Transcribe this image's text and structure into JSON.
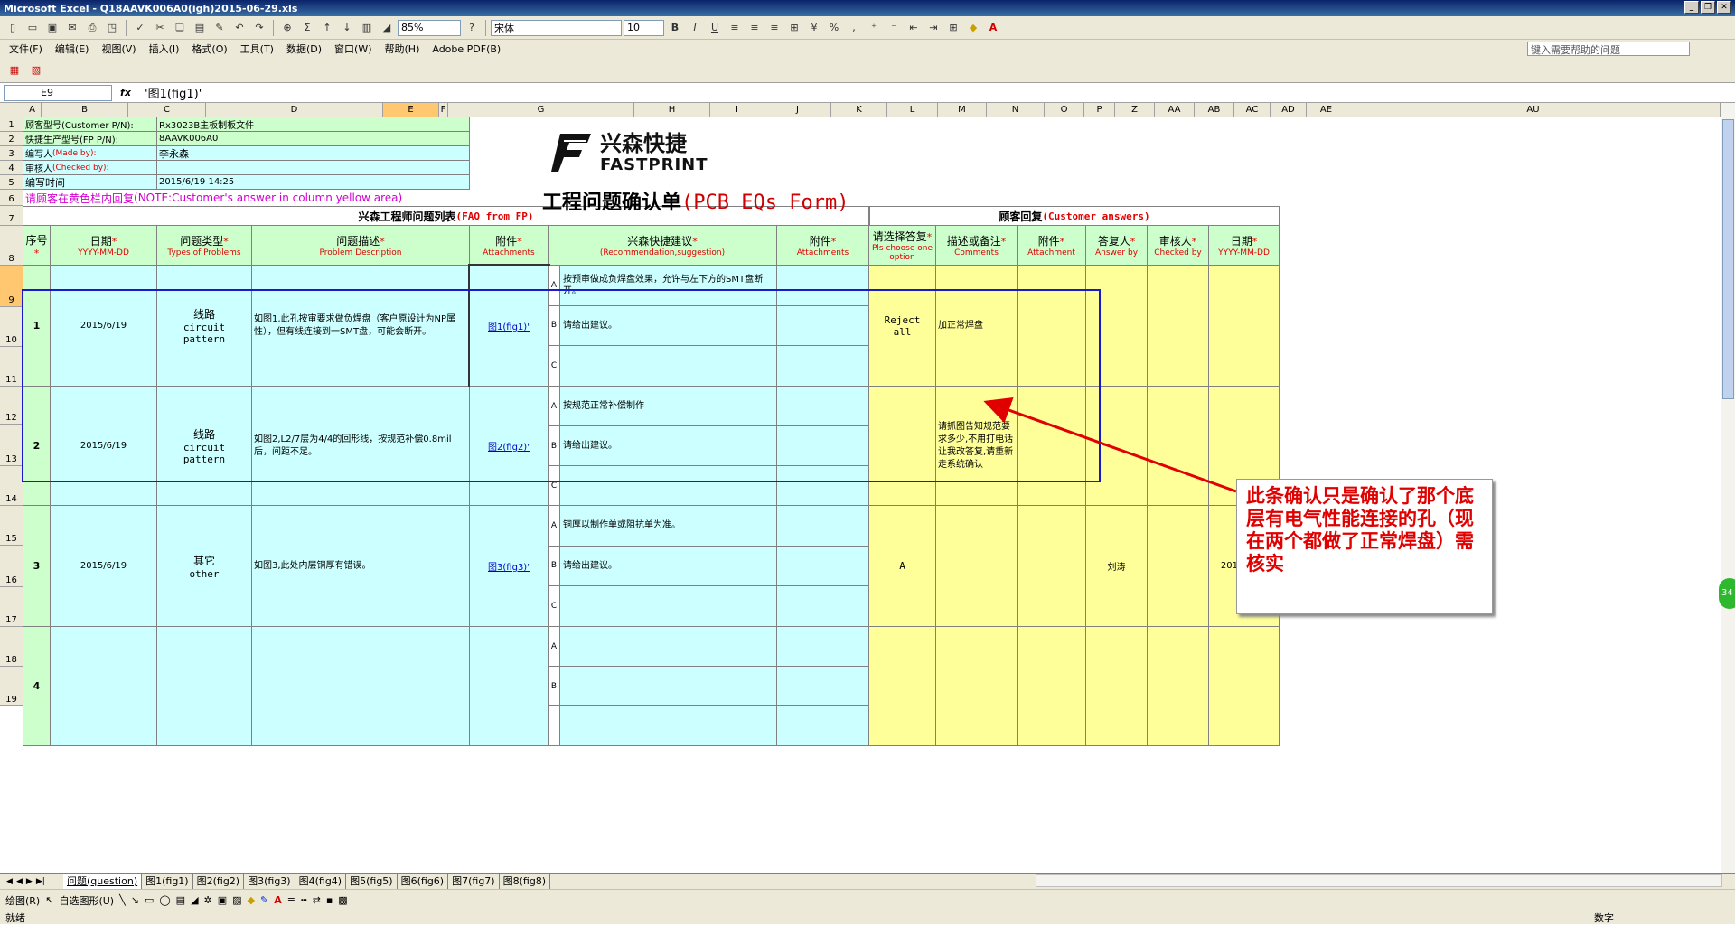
{
  "window": {
    "title": "Microsoft Excel - Q18AAVK006A0(igh)2015-06-29.xls"
  },
  "toolbar": {
    "zoom": "85%",
    "font_name": "宋体",
    "font_size": "10"
  },
  "menu": {
    "items": [
      "文件(F)",
      "编辑(E)",
      "视图(V)",
      "插入(I)",
      "格式(O)",
      "工具(T)",
      "数据(D)",
      "窗口(W)",
      "帮助(H)",
      "Adobe PDF(B)"
    ],
    "help_placeholder": "键入需要帮助的问题"
  },
  "formula": {
    "cell_ref": "E9",
    "fx": "fx",
    "content": "'图1(fig1)'"
  },
  "columns": [
    "A",
    "B",
    "C",
    "D",
    "E",
    "F",
    "G",
    "H",
    "I",
    "J",
    "K",
    "L",
    "M",
    "N",
    "O",
    "P",
    "Z",
    "AA",
    "AB",
    "AC",
    "AD",
    "AE",
    "AU"
  ],
  "rows": [
    "1",
    "2",
    "3",
    "4",
    "5",
    "6",
    "7",
    "8",
    "9",
    "10",
    "11",
    "12",
    "13",
    "14",
    "15",
    "16",
    "17",
    "18",
    "19"
  ],
  "header_info": {
    "customer_pn_label": "顾客型号(Customer P/N):",
    "customer_pn_value": "Rx3023B主板制板文件",
    "fp_pn_label": "快捷生产型号(FP P/N):",
    "fp_pn_value": "8AAVK006A0",
    "made_by_label": "编写人",
    "made_by_en": "(Made by):",
    "made_by_value": "李永森",
    "checked_by_label": "审核人",
    "checked_by_en": "(Checked by):",
    "time_label": "编写时间",
    "time_value": "2015/6/19 14:25",
    "note_cn": "请顾客在黄色栏内回复",
    "note_en": "(NOTE:Customer's answer in column yellow area)"
  },
  "logo": {
    "cn": "兴森快捷",
    "en": "FASTPRINT"
  },
  "form_title": {
    "cn": "工程问题确认单",
    "en": "(PCB EQs Form)"
  },
  "section_headers": {
    "fp_cn": "兴森工程师问题列表",
    "fp_en": "(FAQ from FP)",
    "cust_cn": "顾客回复",
    "cust_en": "(Customer answers)"
  },
  "col_headers": {
    "seq_cn": "序号",
    "date_cn": "日期",
    "date_en": "YYYY-MM-DD",
    "type_cn": "问题类型",
    "type_en": "Types of Problems",
    "desc_cn": "问题描述",
    "desc_en": "Problem Description",
    "attach_cn": "附件",
    "attach_en": "Attachments",
    "sugg_cn": "兴森快捷建议",
    "sugg_en": "(Recommendation,suggestion)",
    "attach2_cn": "附件",
    "attach2_en": "Attachments",
    "choose_cn": "请选择答复",
    "choose_en": "Pls choose one option",
    "comments_cn": "描述或备注",
    "comments_en": "Comments",
    "attach3_cn": "附件",
    "attach3_en": "Attachment",
    "answer_cn": "答复人",
    "answer_en": "Answer by",
    "checked_cn": "审核人",
    "checked_en": "Checked by",
    "date2_cn": "日期",
    "date2_en": "YYYY-MM-DD",
    "star": "*"
  },
  "items": [
    {
      "no": "1",
      "date": "2015/6/19",
      "type_cn": "线路",
      "type_en": "circuit pattern",
      "desc": "如图1,此孔按审要求做负焊盘（客户原设计为NP属性），但有线连接到一SMT盘，可能会断开。",
      "attach": "图1(fig1)'",
      "opts": [
        "A",
        "B",
        "C"
      ],
      "sugg": [
        "按预审做成负焊盘效果，允许与左下方的SMT盘断开。",
        "请给出建议。",
        ""
      ],
      "choose": "Reject all",
      "comment": "加正常焊盘",
      "answer_by": "",
      "date2": ""
    },
    {
      "no": "2",
      "date": "2015/6/19",
      "type_cn": "线路",
      "type_en": "circuit pattern",
      "desc": "如图2,L2/7层为4/4的回形线，按规范补偿0.8mil后，间距不足。",
      "attach": "图2(fig2)'",
      "opts": [
        "A",
        "B",
        "C"
      ],
      "sugg": [
        "按规范正常补偿制作",
        "请给出建议。",
        ""
      ],
      "choose": "",
      "comment": "请抓图告知规范要求多少,不用打电话让我改答复,请重新走系统确认",
      "answer_by": "",
      "date2": ""
    },
    {
      "no": "3",
      "date": "2015/6/19",
      "type_cn": "其它",
      "type_en": "other",
      "desc": "如图3,此处内层铜厚有错误。",
      "attach": "图3(fig3)'",
      "opts": [
        "A",
        "B",
        "C"
      ],
      "sugg": [
        "铜厚以制作单或阻抗单为准。",
        "请给出建议。",
        ""
      ],
      "choose": "A",
      "comment": "",
      "answer_by": "刘涛",
      "date2": "2015/6/19"
    },
    {
      "no": "4",
      "date": "",
      "type_cn": "",
      "type_en": "",
      "desc": "",
      "attach": "",
      "opts": [
        "A",
        "B"
      ],
      "sugg": [
        "",
        ""
      ],
      "choose": "",
      "comment": "",
      "answer_by": "",
      "date2": ""
    }
  ],
  "callout": "此条确认只是确认了那个底层有电气性能连接的孔（现在两个都做了正常焊盘）需核实",
  "sheet_tabs": [
    "问题(question)",
    "图1(fig1)",
    "图2(fig2)",
    "图3(fig3)",
    "图4(fig4)",
    "图5(fig5)",
    "图6(fig6)",
    "图7(fig7)",
    "图8(fig8)"
  ],
  "drawbar": {
    "draw": "绘图(R)",
    "autoshapes": "自选图形(U)"
  },
  "status": {
    "left": "就绪",
    "right": "数字"
  },
  "badge": "34"
}
